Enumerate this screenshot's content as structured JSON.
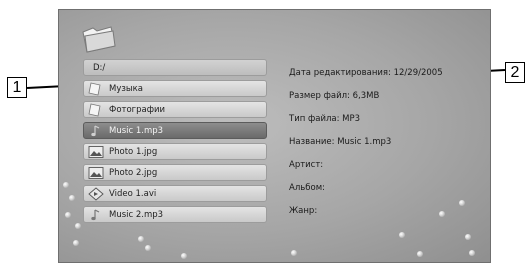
{
  "callouts": {
    "left": "1",
    "right": "2"
  },
  "path": "D:/",
  "files": [
    {
      "label": "Музыка",
      "icon": "folder-icon"
    },
    {
      "label": "Фотографии",
      "icon": "folder-icon"
    },
    {
      "label": "Music 1.mp3",
      "icon": "music-note-icon",
      "selected": true
    },
    {
      "label": "Photo 1.jpg",
      "icon": "photo-icon"
    },
    {
      "label": "Photo 2.jpg",
      "icon": "photo-icon"
    },
    {
      "label": "Video 1.avi",
      "icon": "video-icon"
    },
    {
      "label": "Music 2.mp3",
      "icon": "music-note-icon"
    }
  ],
  "info": {
    "date": "Дата редактирования: 12/29/2005",
    "size": "Размер файл: 6,3MB",
    "type": "Тип файла: MP3",
    "title": "Название: Music 1.mp3",
    "artist": "Артист:",
    "album": "Альбом:",
    "genre": "Жанр:"
  },
  "colors": {
    "selected_row": "#6a6a6a",
    "screen_bg": "#a6a6a6"
  }
}
